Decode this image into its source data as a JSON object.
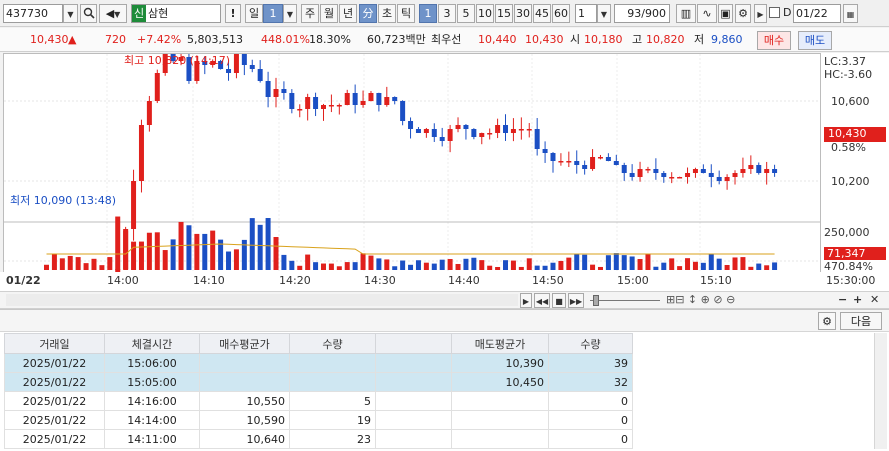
{
  "toolbar": {
    "code": "437730",
    "sin_badge": "신",
    "name": "삼현",
    "bang": "!",
    "period_day": "일",
    "period_val": "1",
    "week": "주",
    "month": "월",
    "year": "년",
    "minute": "分",
    "second": "초",
    "tick": "틱",
    "intervals": [
      "1",
      "3",
      "5",
      "10",
      "15",
      "30",
      "45",
      "60"
    ],
    "interval_selected": "1",
    "count_input": "1",
    "count_display": "93/900",
    "date_checkbox_label": "D",
    "date_value": "01/22"
  },
  "quote": {
    "price": "10,430",
    "change_arrow": "▲",
    "change": "720",
    "change_pct": "+7.42%",
    "volume": "5,803,513",
    "vol_ratio": "448.01%",
    "turnover": "18.30%",
    "amount": "60,723백만",
    "best_label": "최우선",
    "best_ask": "10,440",
    "best_bid": "10,430",
    "open_label": "시",
    "open": "10,180",
    "high_label": "고",
    "high": "10,820",
    "low_label": "저",
    "low": "9,860",
    "buy_btn": "매수",
    "sell_btn": "매도"
  },
  "chart": {
    "high_marker": "최고 10,820 (14:17)",
    "low_marker": "최저 10,090 (13:48)",
    "lc": "LC:3.37",
    "hc": "HC:-3.60",
    "price_ticks": [
      "10,600",
      "10,400",
      "10,200"
    ],
    "current_price": "10,430",
    "current_pct": "0.58%",
    "volume_tick": "250,000",
    "volume_current": "71,347",
    "volume_pct": "470.84%",
    "time_date": "01/22",
    "time_labels": [
      "14:00",
      "14:10",
      "14:20",
      "14:30",
      "14:40",
      "14:50",
      "15:00",
      "15:10"
    ],
    "time_end": "15:30:00",
    "colors": {
      "up": "#e0201c",
      "down": "#1b4fc4",
      "ma": "#d9a21b"
    }
  },
  "chart_data": {
    "type": "candlestick",
    "title": "",
    "xlabel": "",
    "ylabel": "",
    "ylim": [
      10000,
      10900
    ],
    "x_ticks": [
      "14:00",
      "14:10",
      "14:20",
      "14:30",
      "14:40",
      "14:50",
      "15:00",
      "15:10"
    ],
    "y_ticks": [
      10600,
      10400,
      10200
    ],
    "session_high": 10820,
    "session_low": 10090,
    "last": 10430,
    "volume_y_tick": 250000,
    "last_volume": 71347
  },
  "panel": {
    "next_btn": "다음",
    "columns": [
      "거래일",
      "체결시간",
      "매수평균가",
      "수량",
      "",
      "매도평균가",
      "수량"
    ],
    "rows": [
      [
        "2025/01/22",
        "15:06:00",
        "",
        "",
        "",
        "10,390",
        "39"
      ],
      [
        "2025/01/22",
        "15:05:00",
        "",
        "",
        "",
        "10,450",
        "32"
      ],
      [
        "2025/01/22",
        "14:16:00",
        "10,550",
        "5",
        "",
        "",
        "0"
      ],
      [
        "2025/01/22",
        "14:14:00",
        "10,590",
        "19",
        "",
        "",
        "0"
      ],
      [
        "2025/01/22",
        "14:11:00",
        "10,640",
        "23",
        "",
        "",
        "0"
      ]
    ]
  }
}
